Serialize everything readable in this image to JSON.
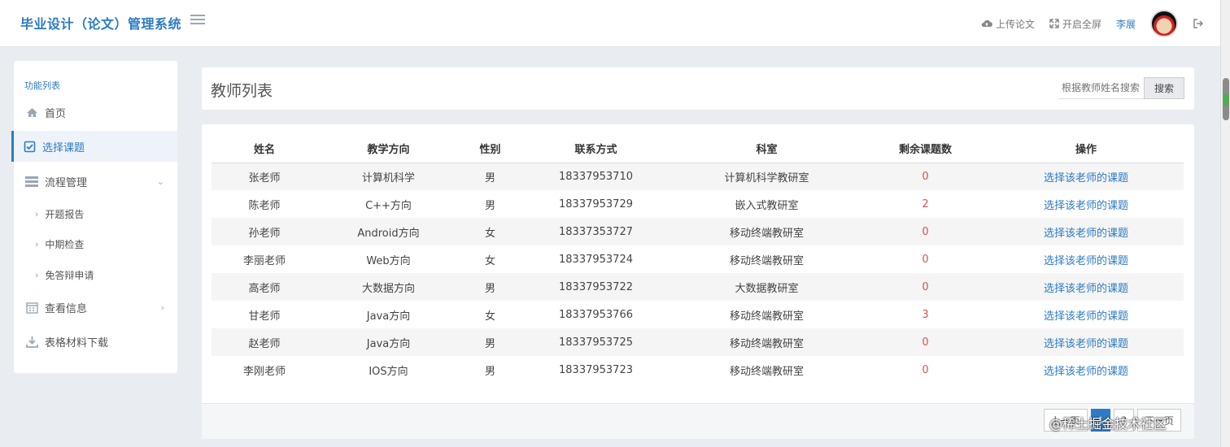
{
  "header": {
    "brand": "毕业设计（论文）管理系统",
    "upload": "上传论文",
    "fullscreen": "开启全屏",
    "user": "李展"
  },
  "sidebar": {
    "title": "功能列表",
    "items": [
      {
        "label": "首页",
        "icon": "home-icon"
      },
      {
        "label": "选择课题",
        "icon": "checkbox-icon",
        "active": true
      },
      {
        "label": "流程管理",
        "icon": "list-icon"
      },
      {
        "label": "查看信息",
        "icon": "calendar-icon"
      },
      {
        "label": "表格材料下载",
        "icon": "download-icon"
      }
    ],
    "subitems": [
      "开题报告",
      "中期检查",
      "免答辩申请"
    ]
  },
  "page": {
    "title": "教师列表",
    "search_placeholder": "根据教师姓名搜索",
    "search_button": "搜索"
  },
  "table": {
    "headers": [
      "姓名",
      "教学方向",
      "性别",
      "联系方式",
      "科室",
      "剩余课题数",
      "操作"
    ],
    "rows": [
      [
        "张老师",
        "计算机科学",
        "男",
        "18337953710",
        "计算机科学教研室",
        "0",
        "选择该老师的课题"
      ],
      [
        "陈老师",
        "C++方向",
        "男",
        "18337953729",
        "嵌入式教研室",
        "2",
        "选择该老师的课题"
      ],
      [
        "孙老师",
        "Android方向",
        "女",
        "18337353727",
        "移动终端教研室",
        "0",
        "选择该老师的课题"
      ],
      [
        "李丽老师",
        "Web方向",
        "女",
        "18337953724",
        "移动终端教研室",
        "0",
        "选择该老师的课题"
      ],
      [
        "高老师",
        "大数据方向",
        "男",
        "18337953722",
        "大数据教研室",
        "0",
        "选择该老师的课题"
      ],
      [
        "甘老师",
        "Java方向",
        "女",
        "18337953766",
        "移动终端教研室",
        "3",
        "选择该老师的课题"
      ],
      [
        "赵老师",
        "Java方向",
        "男",
        "18337953725",
        "移动终端教研室",
        "0",
        "选择该老师的课题"
      ],
      [
        "李刚老师",
        "IOS方向",
        "男",
        "18337953723",
        "移动终端教研室",
        "0",
        "选择该老师的课题"
      ]
    ]
  },
  "pager": {
    "prev": "上一页",
    "pages": [
      "1",
      "2"
    ],
    "next": "下一页"
  },
  "watermark": "@稀土掘金技术社区",
  "colors": {
    "brand": "#2d7bc4",
    "count": "#d9534f"
  }
}
